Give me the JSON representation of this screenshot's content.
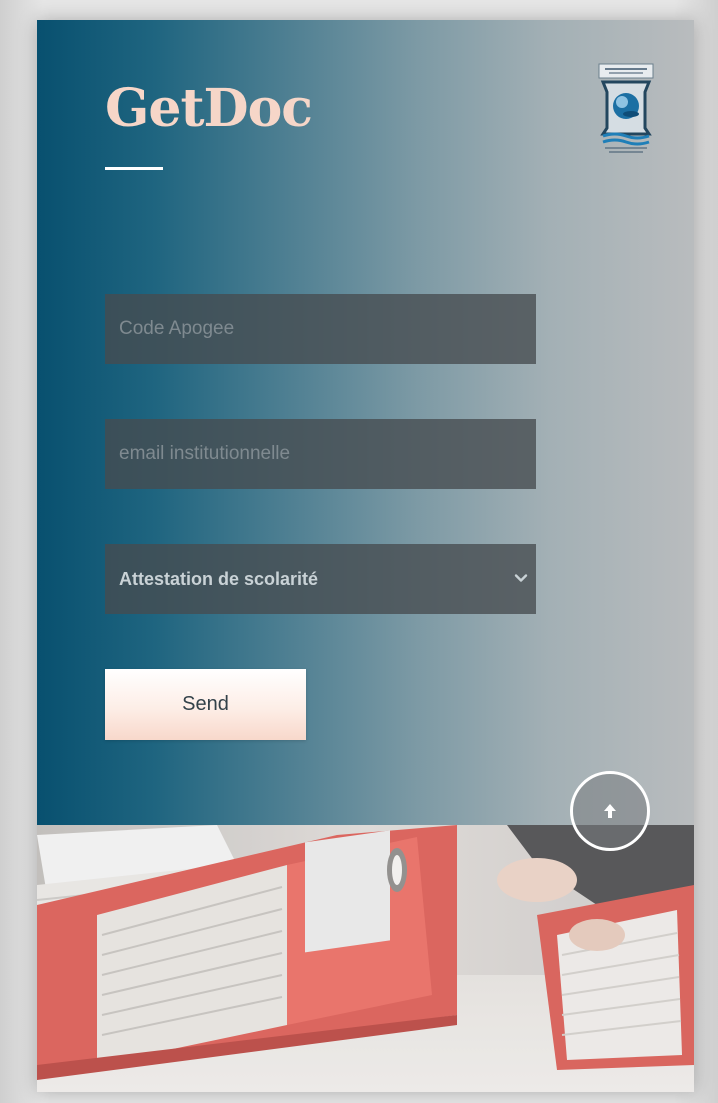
{
  "header": {
    "title": "GetDoc",
    "logo_icon": "university-logo-icon"
  },
  "form": {
    "code_apogee": {
      "placeholder": "Code Apogee",
      "value": ""
    },
    "email": {
      "placeholder": "email institutionnelle",
      "value": ""
    },
    "document_type": {
      "selected": "Attestation de scolarité",
      "icon": "chevron-down-icon"
    },
    "send_label": "Send"
  },
  "scroll_top": {
    "icon": "arrow-up-icon"
  },
  "colors": {
    "title": "#f6d6c8",
    "gradient_start": "#08506f",
    "gradient_end": "#b9bcbe",
    "field_bg": "#464c50",
    "button_bg": "#fdeee7"
  }
}
